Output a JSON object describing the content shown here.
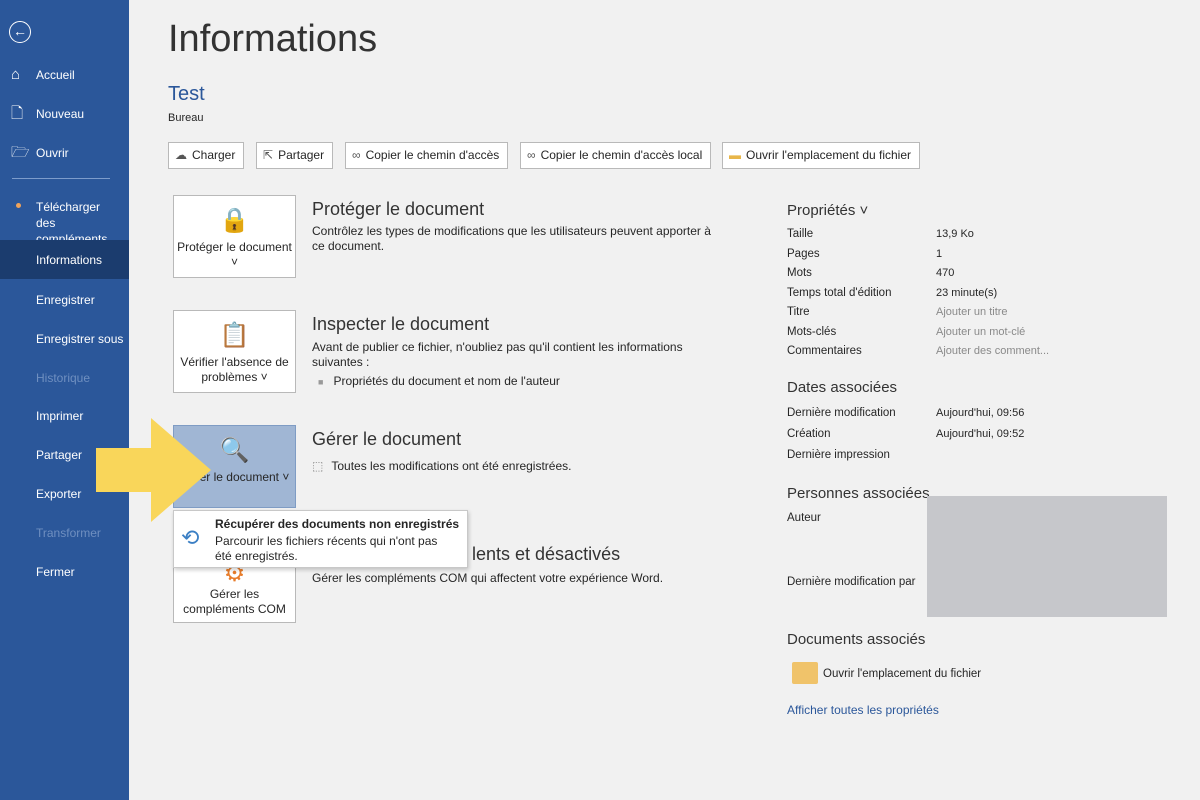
{
  "sidebar": {
    "items": [
      {
        "label": "Accueil",
        "icon": "home-icon"
      },
      {
        "label": "Nouveau",
        "icon": "new-document-icon"
      },
      {
        "label": "Ouvrir",
        "icon": "folder-open-icon"
      },
      {
        "label": "Télécharger des compléments"
      },
      {
        "label": "Informations",
        "selected": true
      },
      {
        "label": "Enregistrer"
      },
      {
        "label": "Enregistrer sous"
      },
      {
        "label": "Historique",
        "disabled": true
      },
      {
        "label": "Imprimer"
      },
      {
        "label": "Partager"
      },
      {
        "label": "Exporter"
      },
      {
        "label": "Transformer",
        "disabled": true
      },
      {
        "label": "Fermer"
      }
    ]
  },
  "header": {
    "title": "Informations",
    "doc_name": "Test",
    "location": "Bureau"
  },
  "toolbar": [
    "Charger",
    "Partager",
    "Copier le chemin d'accès",
    "Copier le chemin d'accès local",
    "Ouvrir l'emplacement du fichier"
  ],
  "sections": [
    {
      "button": "Protéger le document ˅",
      "title": "Protéger le document",
      "desc": "Contrôlez les types de modifications que les utilisateurs peuvent apporter à ce document."
    },
    {
      "button": "Vérifier l'absence de problèmes ˅",
      "title": "Inspecter le document",
      "desc": "Avant de publier ce fichier, n'oubliez pas qu'il contient les informations suivantes :",
      "bullet": "Propriétés du document et nom de l'auteur"
    },
    {
      "button": "Gérer le document ˅",
      "title": "Gérer le document",
      "desc": "Toutes les modifications ont été enregistrées."
    },
    {
      "button": "Gérer les compléments COM",
      "title": "lents et désactivés",
      "desc": "Gérer les compléments COM qui affectent votre expérience Word."
    }
  ],
  "popup": {
    "title": "Récupérer des documents non enregistrés",
    "desc": "Parcourir les fichiers récents qui n'ont pas été enregistrés."
  },
  "properties": {
    "heading": "Propriétés ˅",
    "rows": [
      [
        "Taille",
        "13,9 Ko"
      ],
      [
        "Pages",
        "1"
      ],
      [
        "Mots",
        "470"
      ],
      [
        "Temps total d'édition",
        "23 minute(s)"
      ],
      [
        "Titre",
        "Ajouter un titre"
      ],
      [
        "Mots-clés",
        "Ajouter un mot-clé"
      ],
      [
        "Commentaires",
        "Ajouter des comment..."
      ]
    ]
  },
  "dates": {
    "heading": "Dates associées",
    "rows": [
      [
        "Dernière modification",
        "Aujourd'hui, 09:56"
      ],
      [
        "Création",
        "Aujourd'hui, 09:52"
      ],
      [
        "Dernière impression",
        ""
      ]
    ]
  },
  "people": {
    "heading": "Personnes associées",
    "author": "Auteur",
    "last_modified_by": "Dernière modification par"
  },
  "related": {
    "heading": "Documents associés",
    "open_location": "Ouvrir l'emplacement du fichier",
    "show_all": "Afficher toutes les propriétés"
  },
  "colors": {
    "sidebar": "#2b579a",
    "selected": "#1b3c6e",
    "arrow": "#f9d65a"
  }
}
